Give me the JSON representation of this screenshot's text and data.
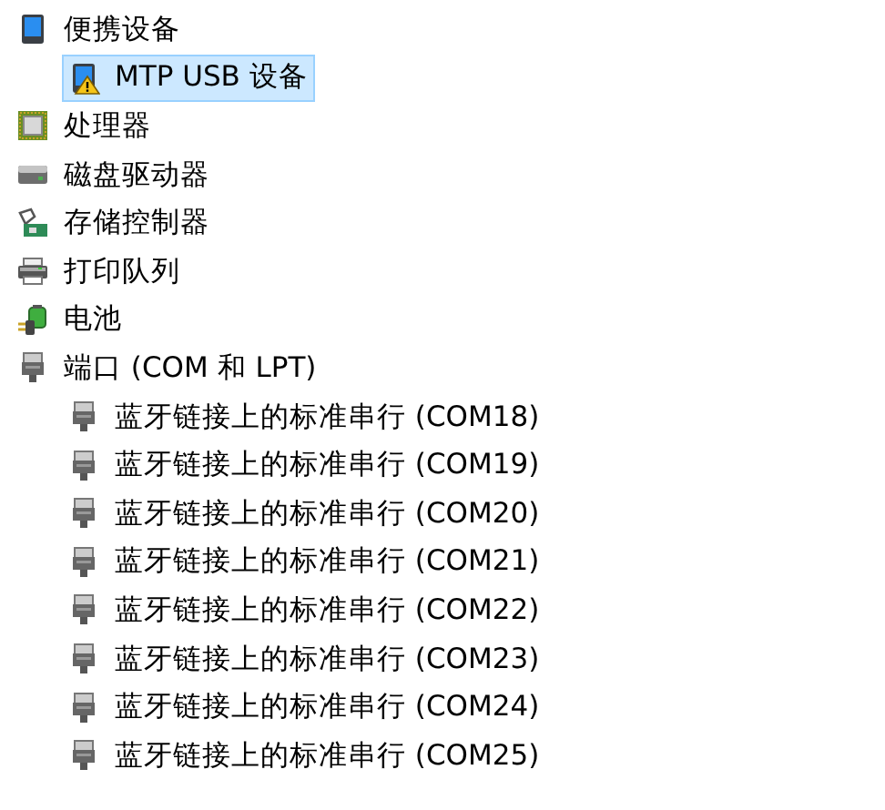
{
  "tree": [
    {
      "label": "便携设备",
      "kind": "portable",
      "selected": false,
      "children": [
        {
          "label": "MTP USB 设备",
          "kind": "portable",
          "warning": true,
          "selected": true
        }
      ]
    },
    {
      "label": "处理器",
      "kind": "processor",
      "selected": false
    },
    {
      "label": "磁盘驱动器",
      "kind": "disk",
      "selected": false
    },
    {
      "label": "存储控制器",
      "kind": "storage",
      "selected": false
    },
    {
      "label": "打印队列",
      "kind": "printer",
      "selected": false
    },
    {
      "label": "电池",
      "kind": "battery",
      "selected": false
    },
    {
      "label": "端口 (COM 和 LPT)",
      "kind": "port",
      "selected": false,
      "children": [
        {
          "label": "蓝牙链接上的标准串行 (COM18)",
          "kind": "port",
          "selected": false
        },
        {
          "label": "蓝牙链接上的标准串行 (COM19)",
          "kind": "port",
          "selected": false
        },
        {
          "label": "蓝牙链接上的标准串行 (COM20)",
          "kind": "port",
          "selected": false
        },
        {
          "label": "蓝牙链接上的标准串行 (COM21)",
          "kind": "port",
          "selected": false
        },
        {
          "label": "蓝牙链接上的标准串行 (COM22)",
          "kind": "port",
          "selected": false
        },
        {
          "label": "蓝牙链接上的标准串行 (COM23)",
          "kind": "port",
          "selected": false
        },
        {
          "label": "蓝牙链接上的标准串行 (COM24)",
          "kind": "port",
          "selected": false
        },
        {
          "label": "蓝牙链接上的标准串行 (COM25)",
          "kind": "port",
          "selected": false
        }
      ]
    }
  ]
}
